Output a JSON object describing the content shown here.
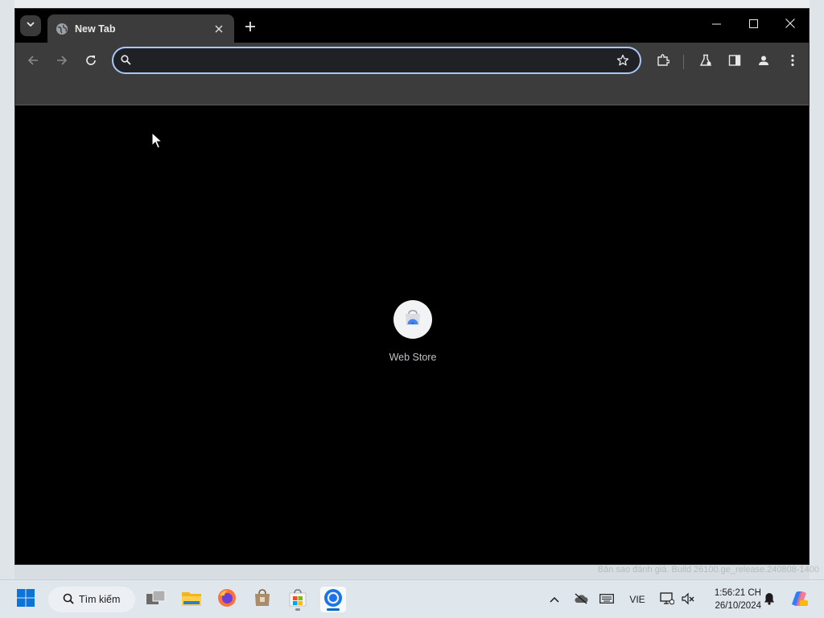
{
  "browser": {
    "tab": {
      "title": "New Tab"
    },
    "omnibox": {
      "value": "",
      "placeholder": ""
    },
    "shortcuts": [
      {
        "label": "Web Store"
      }
    ]
  },
  "desktop": {
    "watermark": "Bản sao đánh giá. Build 26100.ge_release.240808-1400"
  },
  "taskbar": {
    "search_label": "Tìm kiếm",
    "language": "VIE",
    "time": "1:56:21 CH",
    "date": "26/10/2024"
  },
  "colors": {
    "omnibox_focus": "#a8c7fa",
    "toolbar": "#3c3c3c",
    "content_bg": "#000000",
    "taskbar_bg": "#dfe6ec",
    "accent": "#0067c0"
  },
  "icons": [
    "tab-search-icon",
    "globe-icon",
    "close-icon",
    "plus-icon",
    "minimize-icon",
    "maximize-icon",
    "window-close-icon",
    "back-icon",
    "forward-icon",
    "reload-icon",
    "search-icon",
    "star-icon",
    "extensions-icon",
    "labs-icon",
    "side-panel-icon",
    "profile-icon",
    "menu-icon",
    "web-store-icon",
    "windows-start-icon",
    "task-view-icon",
    "file-explorer-icon",
    "firefox-icon",
    "store-icon",
    "ms-store-icon",
    "chrome-icon",
    "chevron-up-icon",
    "cloud-off-icon",
    "keyboard-icon",
    "network-icon",
    "volume-mute-icon",
    "bell-icon",
    "copilot-icon"
  ]
}
